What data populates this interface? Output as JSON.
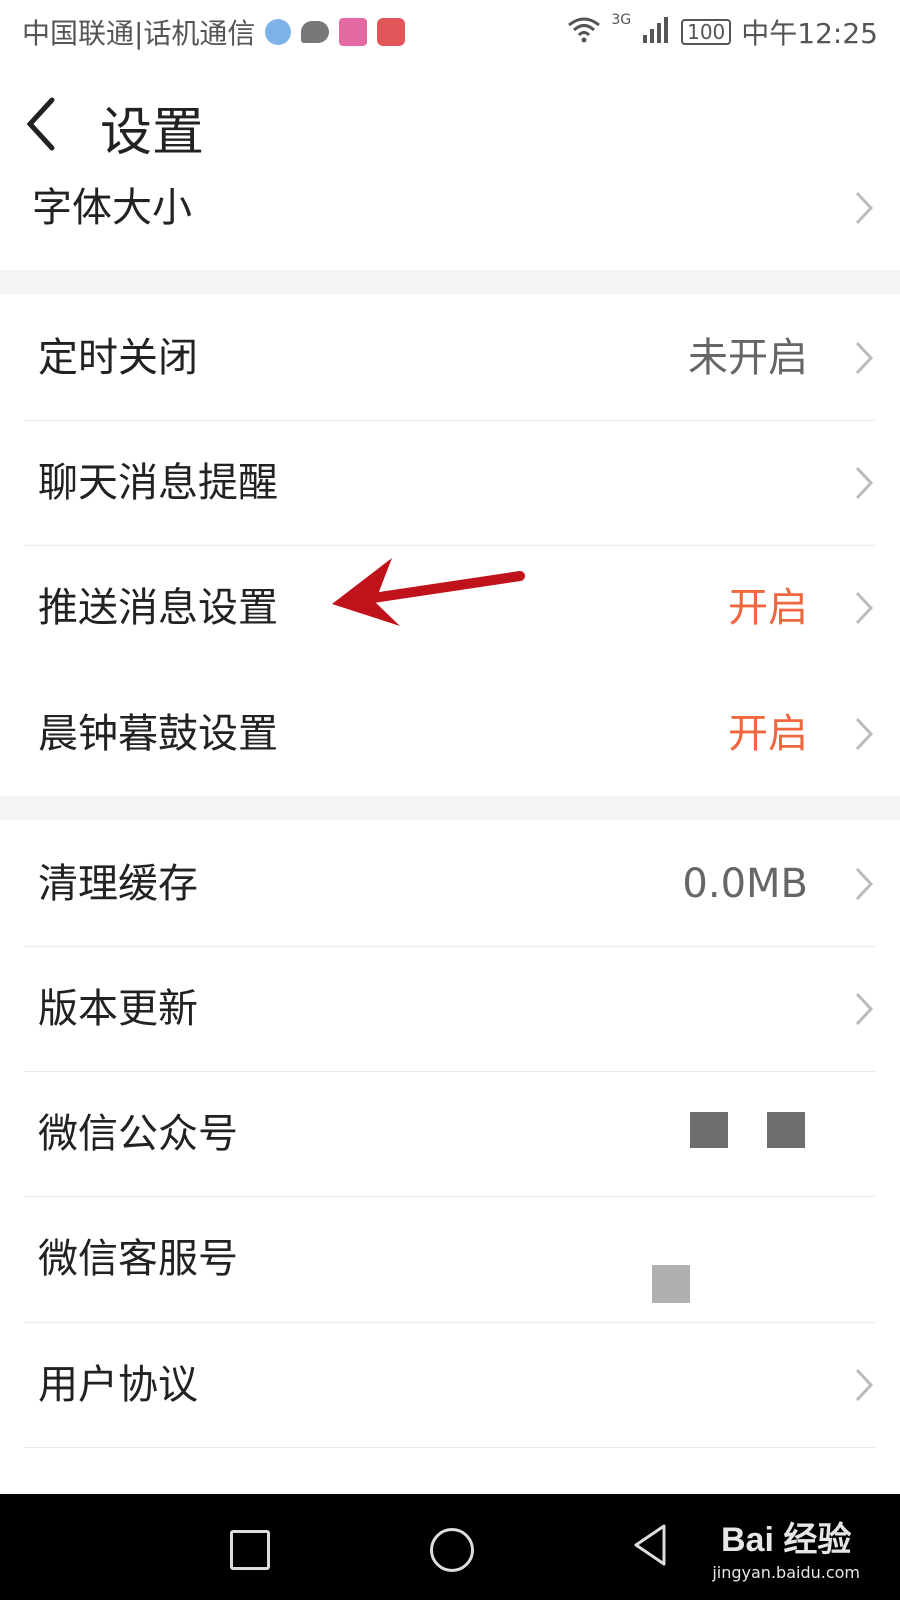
{
  "status_bar": {
    "carrier": "中国联通|话机通信",
    "network": "3G",
    "battery": "100",
    "time": "中午12:25"
  },
  "header": {
    "title": "设置"
  },
  "sections": {
    "font_size": {
      "label": "字体大小"
    },
    "timer_close": {
      "label": "定时关闭",
      "value": "未开启"
    },
    "chat_reminder": {
      "label": "聊天消息提醒"
    },
    "push_settings": {
      "label": "推送消息设置",
      "value": "开启"
    },
    "morning_evening": {
      "label": "晨钟暮鼓设置",
      "value": "开启"
    },
    "clear_cache": {
      "label": "清理缓存",
      "value": "0.0MB"
    },
    "version_update": {
      "label": "版本更新"
    },
    "wechat_official": {
      "label": "微信公众号"
    },
    "wechat_service": {
      "label": "微信客服号"
    },
    "user_agreement": {
      "label": "用户协议"
    }
  },
  "colors": {
    "accent_on": "#f0663f",
    "annotation_arrow": "#c0121b",
    "section_gap": "#f4f4f2"
  },
  "watermark": {
    "logo": "Bai 经验",
    "url": "jingyan.baidu.com"
  }
}
